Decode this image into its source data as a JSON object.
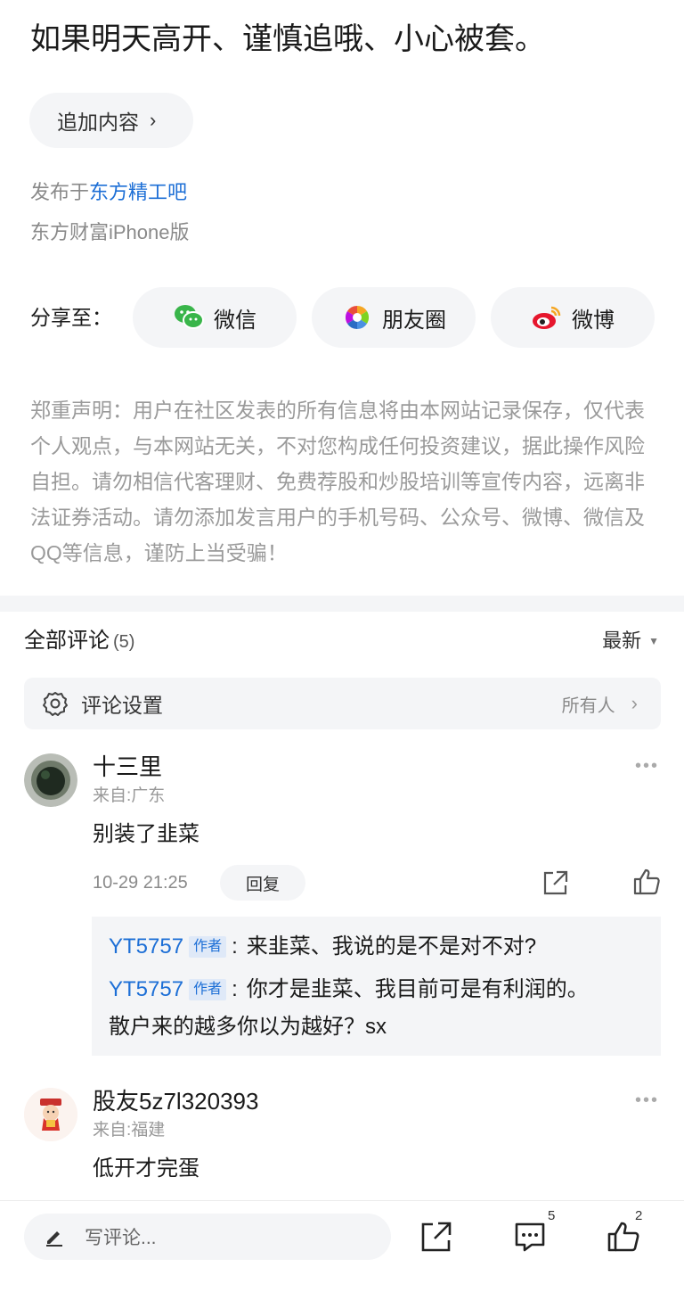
{
  "post": {
    "text": "如果明天高开、谨慎追哦、小心被套。",
    "append_label": "追加内容",
    "published_prefix": "发布于",
    "forum": "东方精工吧",
    "client": "东方财富iPhone版"
  },
  "share": {
    "label": "分享至：",
    "targets": [
      {
        "label": "微信",
        "icon": "wechat-icon",
        "color": "#39b54a"
      },
      {
        "label": "朋友圈",
        "icon": "moments-icon",
        "color": "#f5a623"
      },
      {
        "label": "微博",
        "icon": "weibo-icon",
        "color": "#e6162d"
      }
    ]
  },
  "disclaimer": "郑重声明：用户在社区发表的所有信息将由本网站记录保存，仅代表个人观点，与本网站无关，不对您构成任何投资建议，据此操作风险自担。请勿相信代客理财、免费荐股和炒股培训等宣传内容，远离非法证券活动。请勿添加发言用户的手机号码、公众号、微博、微信及QQ等信息，谨防上当受骗！",
  "comments_header": {
    "title": "全部评论",
    "count": "(5)",
    "sort_label": "最新"
  },
  "comment_settings": {
    "label": "评论设置",
    "value": "所有人"
  },
  "comments": [
    {
      "name": "十三里",
      "location": "来自:广东",
      "text": "别装了韭菜",
      "time": "10-29 21:25",
      "reply_label": "回复",
      "replies": [
        {
          "user": "YT5757",
          "tag": "作者",
          "text": "来韭菜、我说的是不是对不对?"
        },
        {
          "user": "YT5757",
          "tag": "作者",
          "text": "你才是韭菜、我目前可是有利润的。",
          "text2": "散户来的越多你以为越好？sx"
        }
      ]
    },
    {
      "name": "股友5z7l320393",
      "location": "来自:福建",
      "text": "低开才完蛋"
    }
  ],
  "bottom_bar": {
    "write_placeholder": "写评论...",
    "comment_count": "5",
    "like_count": "2"
  },
  "colors": {
    "accent_blue": "#1d6fd6",
    "muted_gray": "#9a9a9a",
    "panel_bg": "#f4f5f7"
  }
}
